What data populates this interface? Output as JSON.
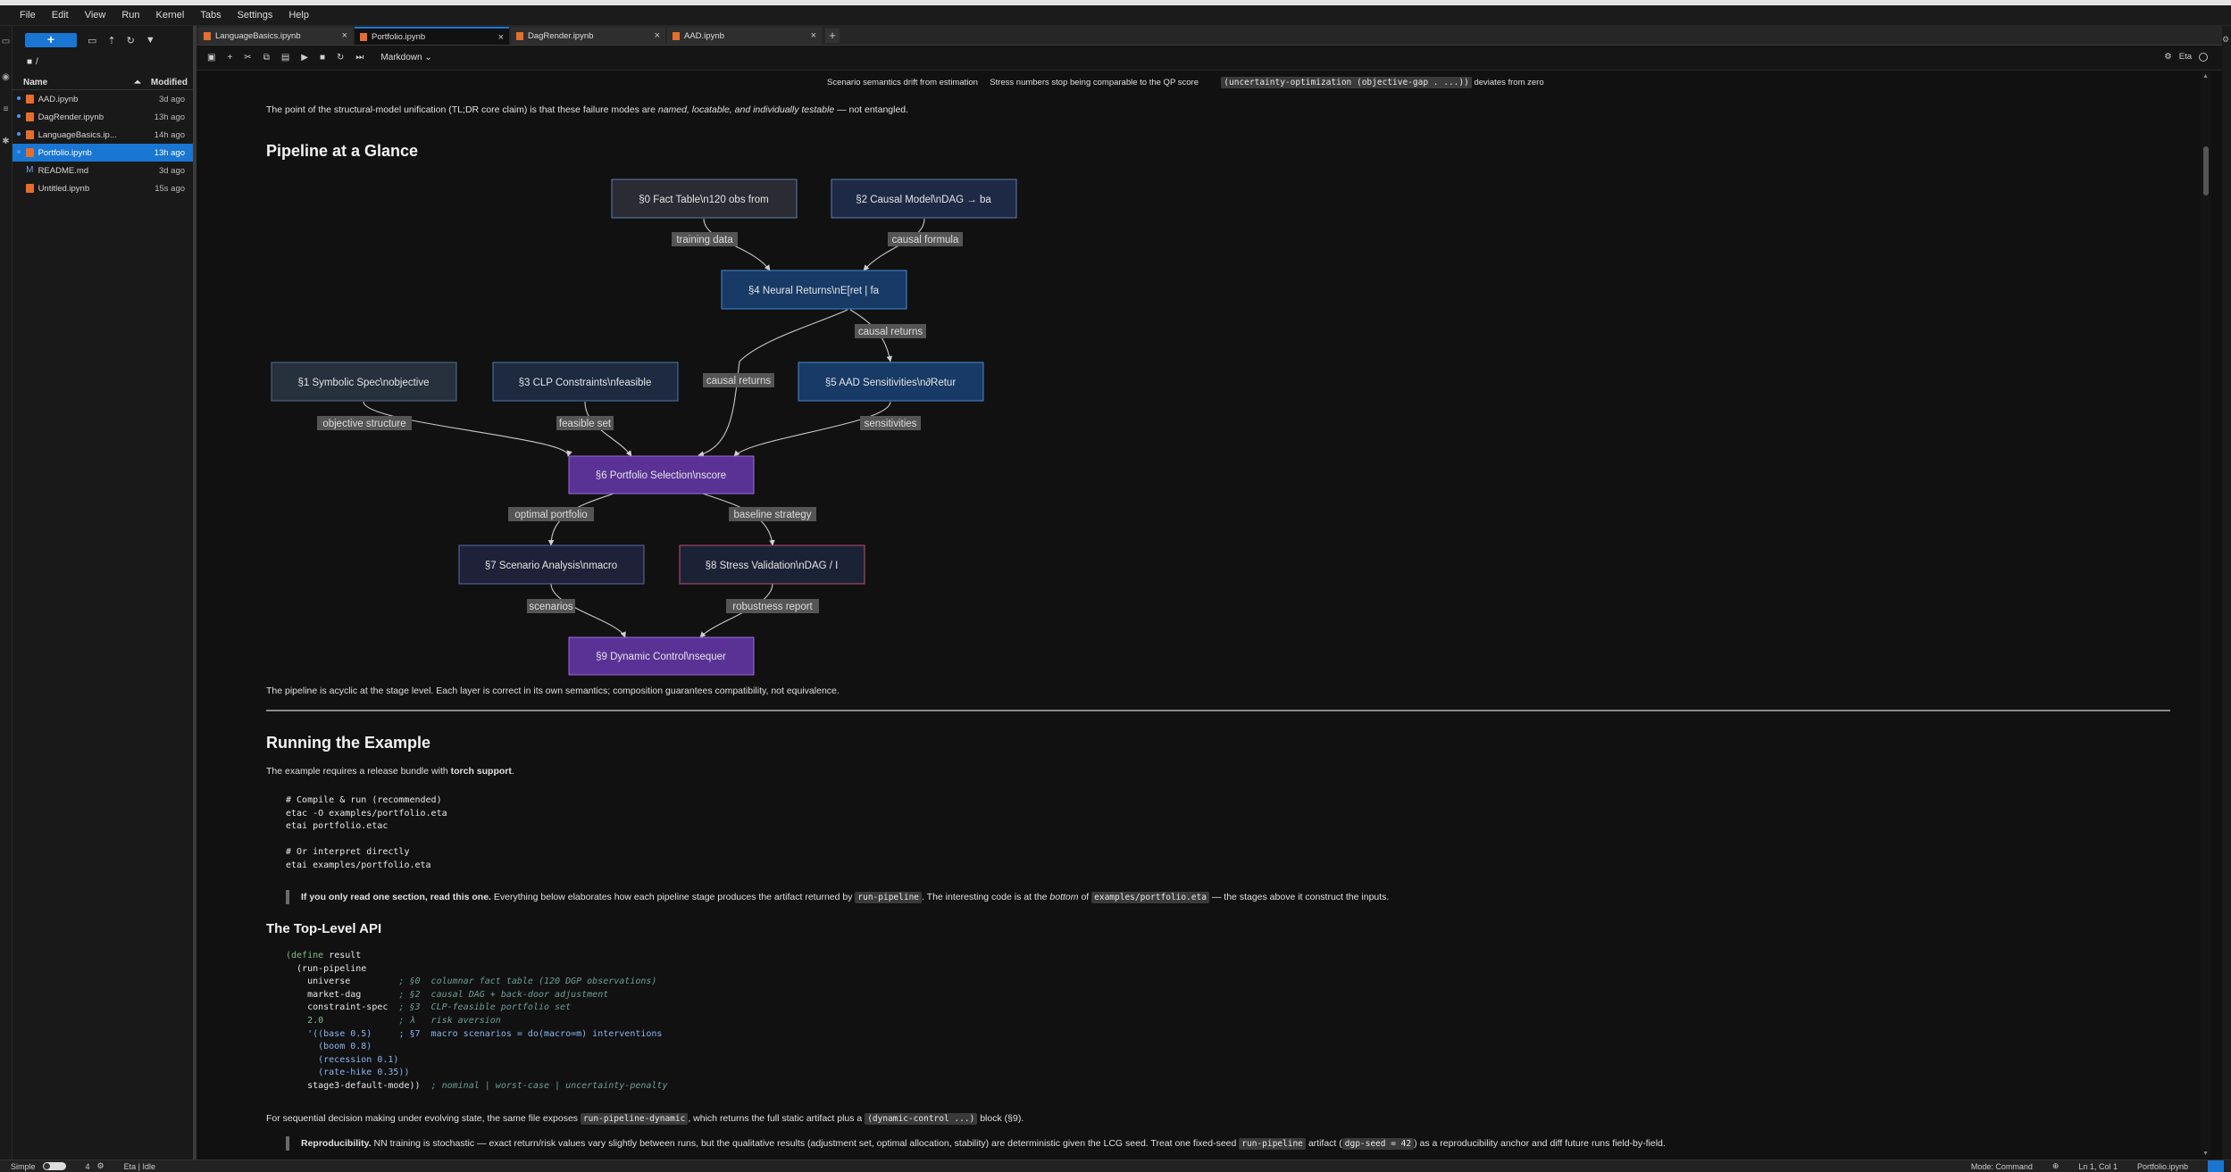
{
  "menu": [
    "File",
    "Edit",
    "View",
    "Run",
    "Kernel",
    "Tabs",
    "Settings",
    "Help"
  ],
  "filebrowser": {
    "new_label": "+",
    "path": "/",
    "col_name": "Name",
    "col_modified": "Modified",
    "files": [
      {
        "name": "AAD.ipynb",
        "modified": "3d ago",
        "type": "notebook",
        "running": true,
        "selected": false
      },
      {
        "name": "DagRender.ipynb",
        "modified": "13h ago",
        "type": "notebook",
        "running": true,
        "selected": false
      },
      {
        "name": "LanguageBasics.ip...",
        "modified": "14h ago",
        "type": "notebook",
        "running": true,
        "selected": false
      },
      {
        "name": "Portfolio.ipynb",
        "modified": "13h ago",
        "type": "notebook",
        "running": true,
        "selected": true
      },
      {
        "name": "README.md",
        "modified": "3d ago",
        "type": "markdown",
        "running": false,
        "selected": false
      },
      {
        "name": "Untitled.ipynb",
        "modified": "15s ago",
        "type": "notebook",
        "running": false,
        "selected": false
      }
    ]
  },
  "tabs": [
    {
      "label": "LanguageBasics.ipynb",
      "active": false
    },
    {
      "label": "Portfolio.ipynb",
      "active": true
    },
    {
      "label": "DagRender.ipynb",
      "active": false
    },
    {
      "label": "AAD.ipynb",
      "active": false
    }
  ],
  "toolbar": {
    "cell_type": "Markdown",
    "kernel_name": "Eta"
  },
  "notebook": {
    "top_line": {
      "t1": "Scenario semantics drift from estimation",
      "t2": "Stress numbers stop being comparable to the QP score",
      "code": "(uncertainty-optimization (objective-gap . ...))",
      "t3": "deviates from zero"
    },
    "p1": {
      "a": "The point of the structural-model unification (TL;DR core claim) is that these failure modes are ",
      "em": "named, locatable, and individually testable",
      "b": " — not entangled."
    },
    "h_pipeline": "Pipeline at a Glance",
    "p_acyclic": "The pipeline is acyclic at the stage level. Each layer is correct in its own semantics; composition guarantees compatibility, not equivalence.",
    "h_running": "Running the Example",
    "p_requires": {
      "a": "The example requires a release bundle with ",
      "strong": "torch support",
      "b": "."
    },
    "code1": [
      "# Compile & run (recommended)",
      "etac -O examples/portfolio.eta",
      "etai portfolio.etac",
      "",
      "# Or interpret directly",
      "etai examples/portfolio.eta"
    ],
    "quote1": {
      "strong": "If you only read one section, read this one.",
      "a": " Everything below elaborates how each pipeline stage produces the artifact returned by ",
      "code1": "run-pipeline",
      "b": ". The interesting code is at the ",
      "em": "bottom",
      "c": " of ",
      "code2": "examples/portfolio.eta",
      "d": " — the stages above it construct the inputs."
    },
    "h_toplevel": "The Top-Level API",
    "code2": {
      "l1a": "(define",
      "l1b": " result",
      "l2": "  (run-pipeline",
      "l3a": "    universe         ",
      "l3b": "; §0  columnar fact table (120 DGP observations)",
      "l4a": "    market-dag       ",
      "l4b": "; §2  causal DAG + back-door adjustment",
      "l5a": "    constraint-spec  ",
      "l5b": "; §3  CLP-feasible portfolio set",
      "l6a": "    2.0              ",
      "l6b": "; λ   risk aversion",
      "l7a": "    '((base 0.5)     ",
      "l7b": "; §7  macro scenarios = do(macro=m) interventions",
      "l8": "      (boom 0.8)",
      "l9": "      (recession 0.1)",
      "l10": "      (rate-hike 0.35))",
      "l11a": "    stage3-default-mode))  ",
      "l11b": "; nominal | worst-case | uncertainty-penalty"
    },
    "p_seq": {
      "a": "For sequential decision making under evolving state, the same file exposes ",
      "code1": "run-pipeline-dynamic",
      "b": ", which returns the full static artifact plus a ",
      "code2": "(dynamic-control ...)",
      "c": " block (§9)."
    },
    "quote2": {
      "strong": "Reproducibility.",
      "a": " NN training is stochastic — exact return/risk values vary slightly between runs, but the qualitative results (adjustment set, optimal allocation, stability) are deterministic given the LCG seed. Treat one fixed-seed ",
      "code1": "run-pipeline",
      "b": " artifact (",
      "code2": "dgp-seed = 42",
      "c": ") as a reproducibility anchor and diff future runs field-by-field."
    }
  },
  "diagram": {
    "nodes": {
      "n0": "§0 Fact Table\\n120 obs from",
      "n2": "§2 Causal Model\\nDAG → ba",
      "n4": "§4 Neural Returns\\nE[ret | fa",
      "n1": "§1 Symbolic Spec\\nobjective",
      "n3": "§3 CLP Constraints\\nfeasible",
      "n5": "§5 AAD Sensitivities\\n∂Retur",
      "n6": "§6 Portfolio Selection\\nscore",
      "n7": "§7 Scenario Analysis\\nmacro",
      "n8": "§8 Stress Validation\\nDAG / I",
      "n9": "§9 Dynamic Control\\nsequer"
    },
    "edges": {
      "training": "training data",
      "causal_formula": "causal formula",
      "causal_returns_a": "causal returns",
      "causal_returns_b": "causal returns",
      "objective": "objective structure",
      "feasible": "feasible set",
      "sensitivities": "sensitivities",
      "optimal": "optimal portfolio",
      "baseline": "baseline strategy",
      "scenarios": "scenarios",
      "robustness": "robustness report"
    }
  },
  "status": {
    "mode_label": "Simple",
    "count": "4",
    "kernel_status": "Eta | Idle",
    "cmd_mode": "Mode: Command",
    "cursor": "Ln 1, Col 1",
    "filename": "Portfolio.ipynb"
  }
}
